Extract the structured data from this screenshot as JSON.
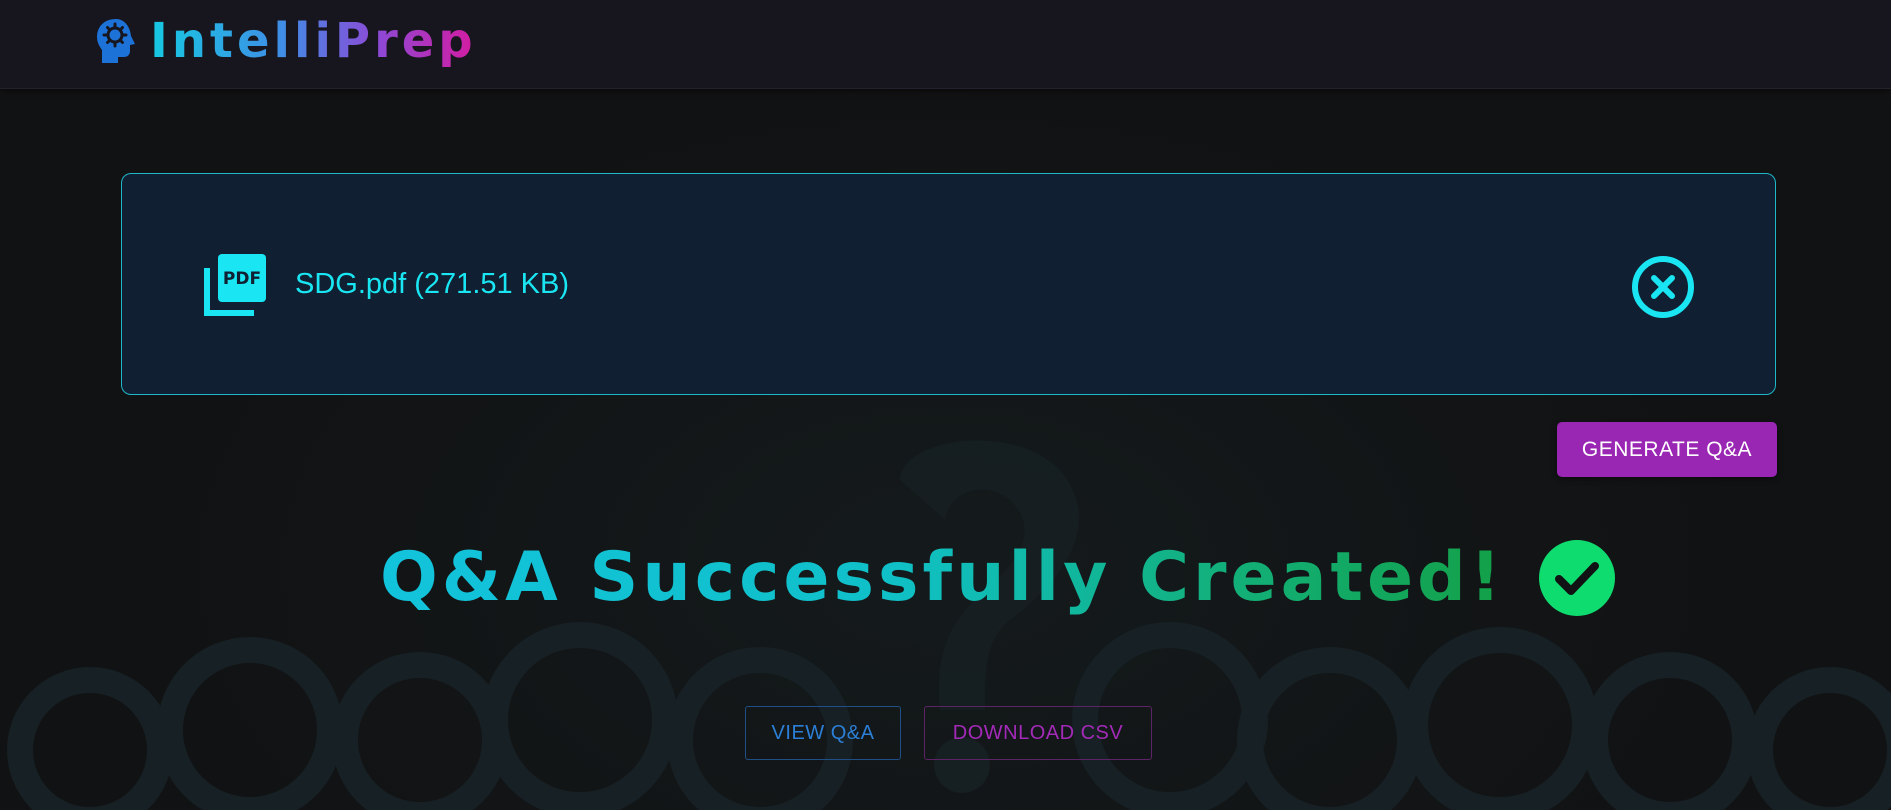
{
  "header": {
    "brand": "IntelliPrep",
    "logo_icon": "head-gear-icon"
  },
  "upload": {
    "file_label": "SDG.pdf (271.51 KB)",
    "file_icon": "pdf-file-icon",
    "remove_icon": "close-circle-icon"
  },
  "actions": {
    "generate_label": "GENERATE Q&A",
    "view_label": "VIEW Q&A",
    "download_label": "DOWNLOAD CSV"
  },
  "status": {
    "message": "Q&A Successfully Created!",
    "icon": "check-circle-icon"
  },
  "colors": {
    "accent_cyan": "#19e6f2",
    "purple": "#9a27b3",
    "success_green": "#0fdc6e",
    "blue": "#2b7fd6",
    "magenta": "#a32ab8"
  }
}
